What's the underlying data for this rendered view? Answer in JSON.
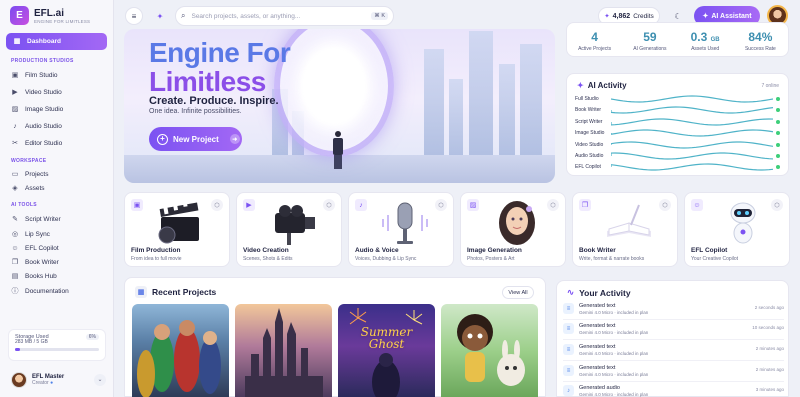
{
  "brand": {
    "name": "EFL.ai",
    "tagline": "ENGINE FOR LIMITLESS",
    "mark": "E"
  },
  "sidebar": {
    "active": {
      "label": "Dashboard",
      "icon": "dashboard-icon"
    },
    "sections": [
      {
        "title": "PRODUCTION STUDIOS",
        "items": [
          {
            "label": "Film Studio",
            "icon": "film-icon",
            "glyph": "▣"
          },
          {
            "label": "Video Studio",
            "icon": "video-icon",
            "glyph": "▶"
          },
          {
            "label": "Image Studio",
            "icon": "image-icon",
            "glyph": "▨"
          },
          {
            "label": "Audio Studio",
            "icon": "audio-icon",
            "glyph": "♪"
          },
          {
            "label": "Editor Studio",
            "icon": "editor-icon",
            "glyph": "✂"
          }
        ]
      },
      {
        "title": "WORKSPACE",
        "items": [
          {
            "label": "Projects",
            "icon": "folder-icon",
            "glyph": "▭"
          },
          {
            "label": "Assets",
            "icon": "assets-icon",
            "glyph": "◈"
          }
        ]
      },
      {
        "title": "AI TOOLS",
        "items": [
          {
            "label": "Script Writer",
            "icon": "script-icon",
            "glyph": "✎"
          },
          {
            "label": "Lip Sync",
            "icon": "lipsync-icon",
            "glyph": "◎"
          },
          {
            "label": "EFL Copilot",
            "icon": "copilot-icon",
            "glyph": "☺"
          },
          {
            "label": "Book Writer",
            "icon": "book-icon",
            "glyph": "❐"
          },
          {
            "label": "Books Hub",
            "icon": "books-hub-icon",
            "glyph": "▤"
          },
          {
            "label": "Documentation",
            "icon": "docs-icon",
            "glyph": "ⓘ"
          }
        ]
      }
    ],
    "storage": {
      "label": "Storage Used",
      "percent_label": "6%",
      "percent": 6,
      "usage": "283 MB / 5 GB"
    },
    "user": {
      "name": "EFL Master",
      "role": "Creator"
    }
  },
  "topbar": {
    "search_placeholder": "Search projects, assets, or anything...",
    "shortcut": "⌘ K",
    "credits_value": "4,862",
    "credits_label": "Credits",
    "ai_button": "AI Assistant"
  },
  "hero": {
    "title_line1": "Engine For",
    "title_line2": "Limitless",
    "subtitle": "Create. Produce. Inspire.",
    "tagline": "One idea. Infinite possibilities.",
    "cta": "New Project"
  },
  "stats": [
    {
      "value": "4",
      "unit": "",
      "label": "Active Projects"
    },
    {
      "value": "59",
      "unit": "",
      "label": "AI Generations"
    },
    {
      "value": "0.3",
      "unit": "GB",
      "label": "Assets Used"
    },
    {
      "value": "84%",
      "unit": "",
      "label": "Success Rate"
    }
  ],
  "ai_activity": {
    "title": "AI Activity",
    "online": "7 online",
    "rows": [
      "Full Studio",
      "Book Writer",
      "Script Writer",
      "Image Studio",
      "Video Studio",
      "Audio Studio",
      "EFL Copilot"
    ]
  },
  "tools": [
    {
      "name": "Film Production",
      "desc": "From idea to full movie",
      "icon": "clapper-icon",
      "glyph": "▣"
    },
    {
      "name": "Video Creation",
      "desc": "Scenes, Shots & Edits",
      "icon": "camera-icon",
      "glyph": "▶"
    },
    {
      "name": "Audio & Voice",
      "desc": "Voices, Dubbing & Lip Sync",
      "icon": "microphone-icon",
      "glyph": "♪"
    },
    {
      "name": "Image Generation",
      "desc": "Photos, Posters & Art",
      "icon": "image-icon",
      "glyph": "▨"
    },
    {
      "name": "Book Writer",
      "desc": "Write, format & narrate books",
      "icon": "book-icon",
      "glyph": "❐"
    },
    {
      "name": "EFL Copilot",
      "desc": "Your Creative Copilot",
      "icon": "robot-icon",
      "glyph": "☺"
    }
  ],
  "recent": {
    "title": "Recent Projects",
    "view_all": "View All",
    "poster_title_line1": "Summer",
    "poster_title_line2": "Ghost"
  },
  "your_activity": {
    "title": "Your Activity",
    "items": [
      {
        "title": "Generated text",
        "sub": "Gemini 4.0 Micro · included in plan",
        "time": "2 seconds ago"
      },
      {
        "title": "Generated text",
        "sub": "Gemini 4.0 Micro · included in plan",
        "time": "10 seconds ago"
      },
      {
        "title": "Generated text",
        "sub": "Gemini 4.0 Micro · included in plan",
        "time": "2 minutes ago"
      },
      {
        "title": "Generated text",
        "sub": "Gemini 4.0 Micro · included in plan",
        "time": "2 minutes ago"
      },
      {
        "title": "Generated audio",
        "sub": "Gemini 4.0 Micro · included in plan",
        "time": "3 minutes ago"
      }
    ]
  },
  "colors": {
    "accent": "#7b52f2",
    "accent2": "#a368f4",
    "hero_blue": "#5a79e6",
    "stat_teal": "#3d8fb0",
    "online_green": "#3ecf7a"
  }
}
